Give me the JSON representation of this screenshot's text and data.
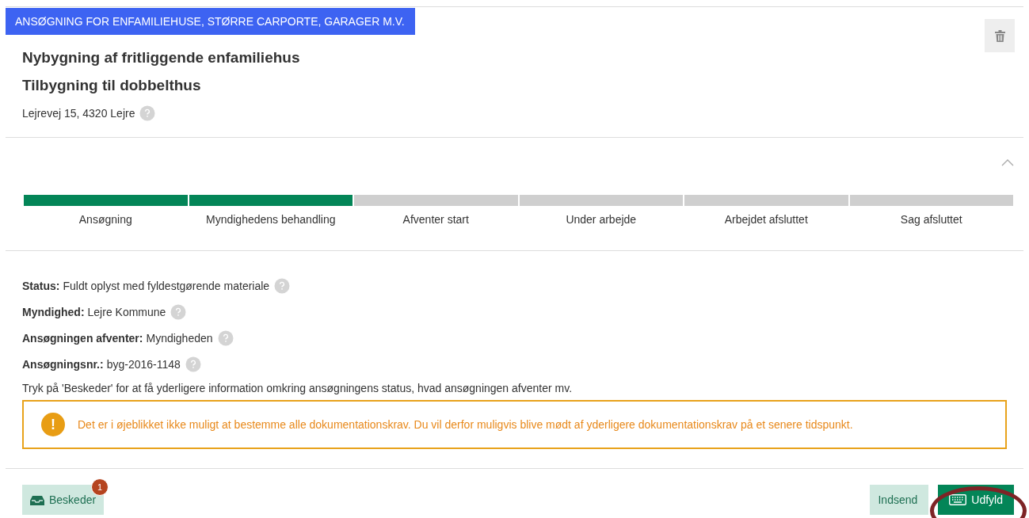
{
  "category_badge": "ANSØGNING FOR ENFAMILIEHUSE, STØRRE CARPORTE, GARAGER M.V.",
  "titles": [
    "Nybygning af fritliggende enfamiliehus",
    "Tilbygning til dobbelthus"
  ],
  "address": "Lejrevej 15, 4320 Lejre",
  "progress": {
    "expanded": true,
    "steps": [
      {
        "label": "Ansøgning",
        "completed": true
      },
      {
        "label": "Myndighedens behandling",
        "completed": true
      },
      {
        "label": "Afventer start",
        "completed": false
      },
      {
        "label": "Under arbejde",
        "completed": false
      },
      {
        "label": "Arbejdet afsluttet",
        "completed": false
      },
      {
        "label": "Sag afsluttet",
        "completed": false
      }
    ]
  },
  "details": [
    {
      "label": "Status:",
      "value": "Fuldt oplyst med fyldestgørende materiale"
    },
    {
      "label": "Myndighed:",
      "value": "Lejre Kommune"
    },
    {
      "label": "Ansøgningen afventer:",
      "value": "Myndigheden"
    },
    {
      "label": "Ansøgningsnr.:",
      "value": "byg-2016-1148"
    }
  ],
  "info_text": "Tryk på 'Beskeder' for at få yderligere information omkring ansøgningens status, hvad ansøgningen afventer mv.",
  "warning": {
    "icon": "!",
    "text": "Det er i øjeblikket ikke muligt at bestemme alle dokumentationskrav. Du vil derfor muligvis blive mødt af yderligere dokumentationskrav på et senere tidspunkt."
  },
  "messages_button": {
    "label": "Beskeder",
    "badge": "1"
  },
  "submit_button": {
    "label": "Indsend"
  },
  "fill_button": {
    "label": "Udfyld",
    "highlighted": true
  }
}
